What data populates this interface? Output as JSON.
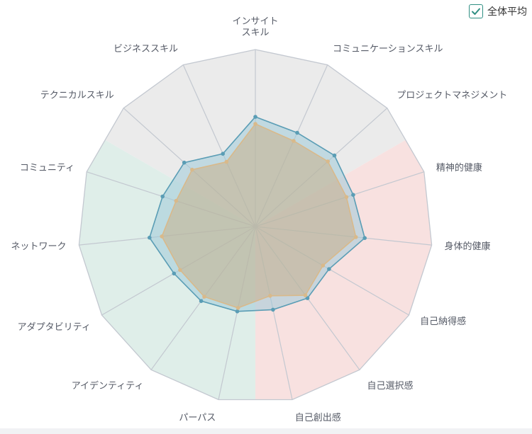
{
  "legend": {
    "label": "全体平均",
    "checked": true,
    "check_icon": "check-icon"
  },
  "colors": {
    "grid_line": "#c3c8d0",
    "zone_gray": "#ebebeb",
    "zone_pink": "#f8e1e0",
    "zone_green": "#dfeee9",
    "series_user_fill": "#9fcbd9",
    "series_user_stroke": "#5a9db5",
    "series_avg_fill": "#c9a87a",
    "series_avg_stroke": "#d9b98a",
    "checkbox": "#2f8f83"
  },
  "chart_data": {
    "type": "radar",
    "title": "",
    "axes": [
      "インサイト\nスキル",
      "コミュニケーションスキル",
      "プロジェクトマネジメント",
      "精神的健康",
      "身体的健康",
      "自己納得感",
      "自己選択感",
      "自己創出感",
      "パーパス",
      "アイデンティティ",
      "アダプタビリティ",
      "ネットワーク",
      "コミュニティ",
      "テクニカルスキル",
      "ビジネススキル"
    ],
    "axis_range": [
      0,
      100
    ],
    "zones": [
      {
        "color": "gray",
        "axes": [
          13,
          14,
          0,
          1,
          2
        ]
      },
      {
        "color": "pink",
        "axes": [
          3,
          4,
          5,
          6,
          7
        ]
      },
      {
        "color": "green",
        "axes": [
          8,
          9,
          10,
          11,
          12
        ]
      }
    ],
    "series": [
      {
        "key": "user",
        "values": [
          62,
          58,
          60,
          58,
          62,
          48,
          50,
          48,
          49,
          52,
          53,
          60,
          55,
          54,
          45
        ]
      },
      {
        "key": "average",
        "values": [
          58,
          53,
          55,
          54,
          57,
          44,
          48,
          40,
          47,
          49,
          49,
          53,
          47,
          48,
          40
        ]
      }
    ]
  }
}
